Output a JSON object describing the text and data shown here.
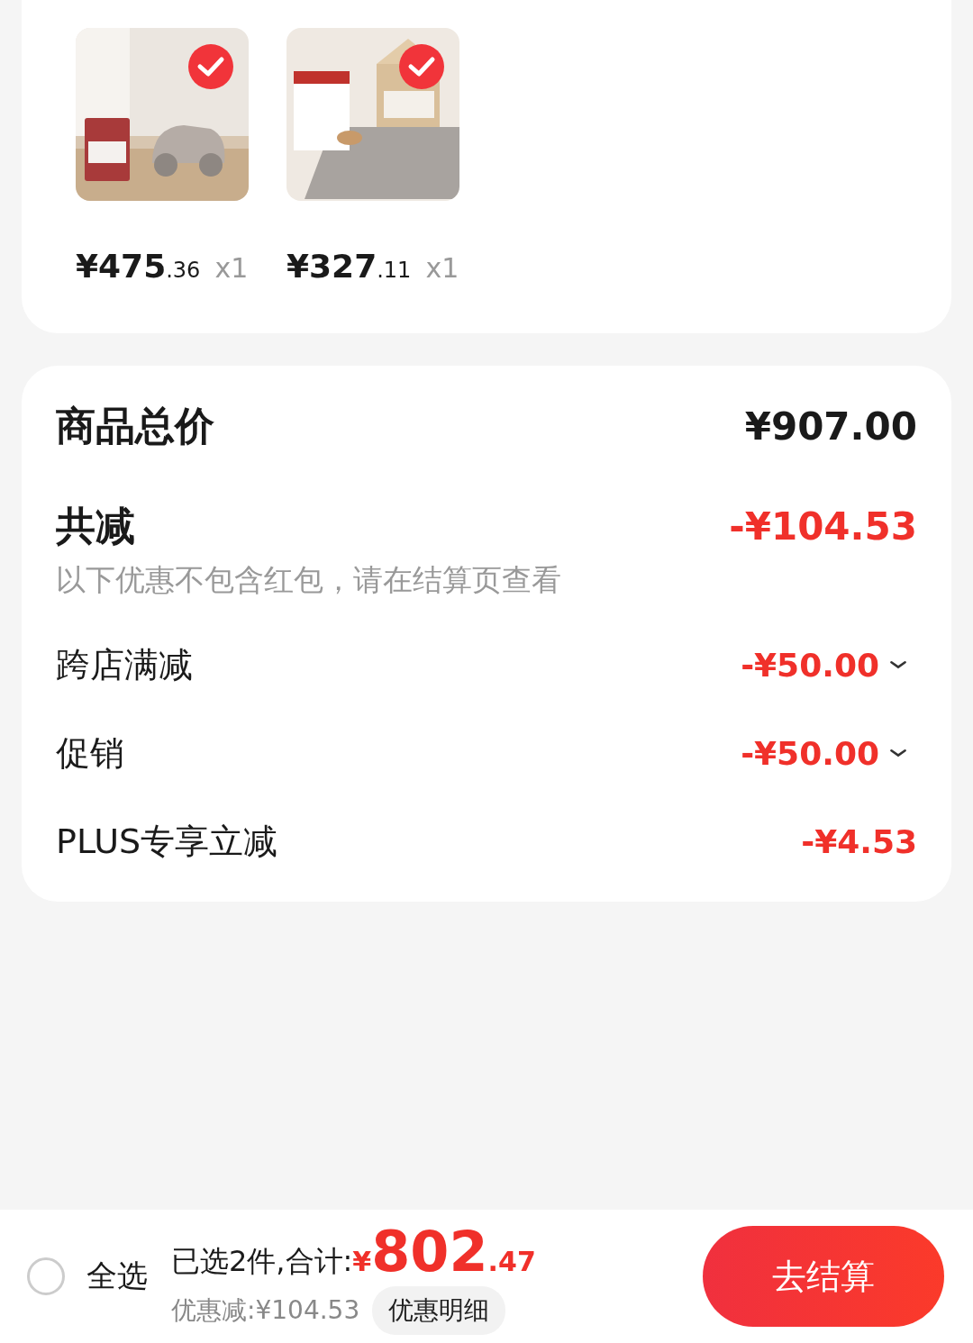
{
  "items": [
    {
      "kind": "picture",
      "selected": true,
      "price_main": "¥475",
      "price_decimal": ".36",
      "quantity": "x1"
    },
    {
      "kind": "picture",
      "selected": true,
      "price_main": "¥327",
      "price_decimal": ".11",
      "quantity": "x1"
    }
  ],
  "summary": {
    "total_label": "商品总价",
    "total_value": "¥907.00",
    "discount_label": "共减",
    "discount_value": "-¥104.53",
    "note": "以下优惠不包含红包，请在结算页查看",
    "rows": [
      {
        "label": "跨店满减",
        "value": "-¥50.00",
        "expandable": true
      },
      {
        "label": "促销",
        "value": "-¥50.00",
        "expandable": true
      },
      {
        "label": "PLUS专享立减",
        "value": "-¥4.53",
        "expandable": false
      }
    ]
  },
  "footer": {
    "select_all": {
      "label": "全选",
      "checked": false
    },
    "selected_text": "已选2件,合计:",
    "total_currency": "¥",
    "total_integer": "802",
    "total_decimal": ".47",
    "saved": "优惠减:¥104.53",
    "details_button": "优惠明细",
    "checkout_button": "去结算"
  }
}
